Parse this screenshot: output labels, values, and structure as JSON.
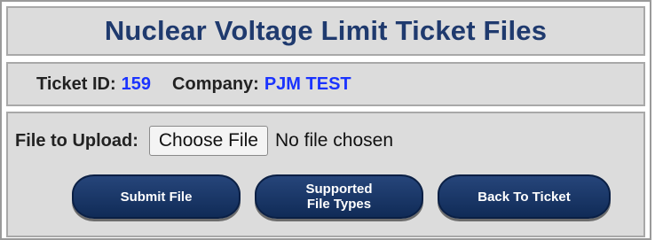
{
  "title": "Nuclear Voltage Limit Ticket Files",
  "ticket": {
    "id_label": "Ticket ID:",
    "id_value": "159",
    "company_label": "Company:",
    "company_value": "PJM TEST"
  },
  "upload": {
    "label": "File to Upload:",
    "choose_button": "Choose File",
    "status": "No file chosen"
  },
  "buttons": {
    "submit": "Submit File",
    "supported_line1": "Supported",
    "supported_line2": "File Types",
    "back": "Back To Ticket"
  },
  "colors": {
    "title": "#1f3a6e",
    "value": "#1a33ff",
    "button": "#1a3564",
    "panel": "#dcdcdc"
  }
}
